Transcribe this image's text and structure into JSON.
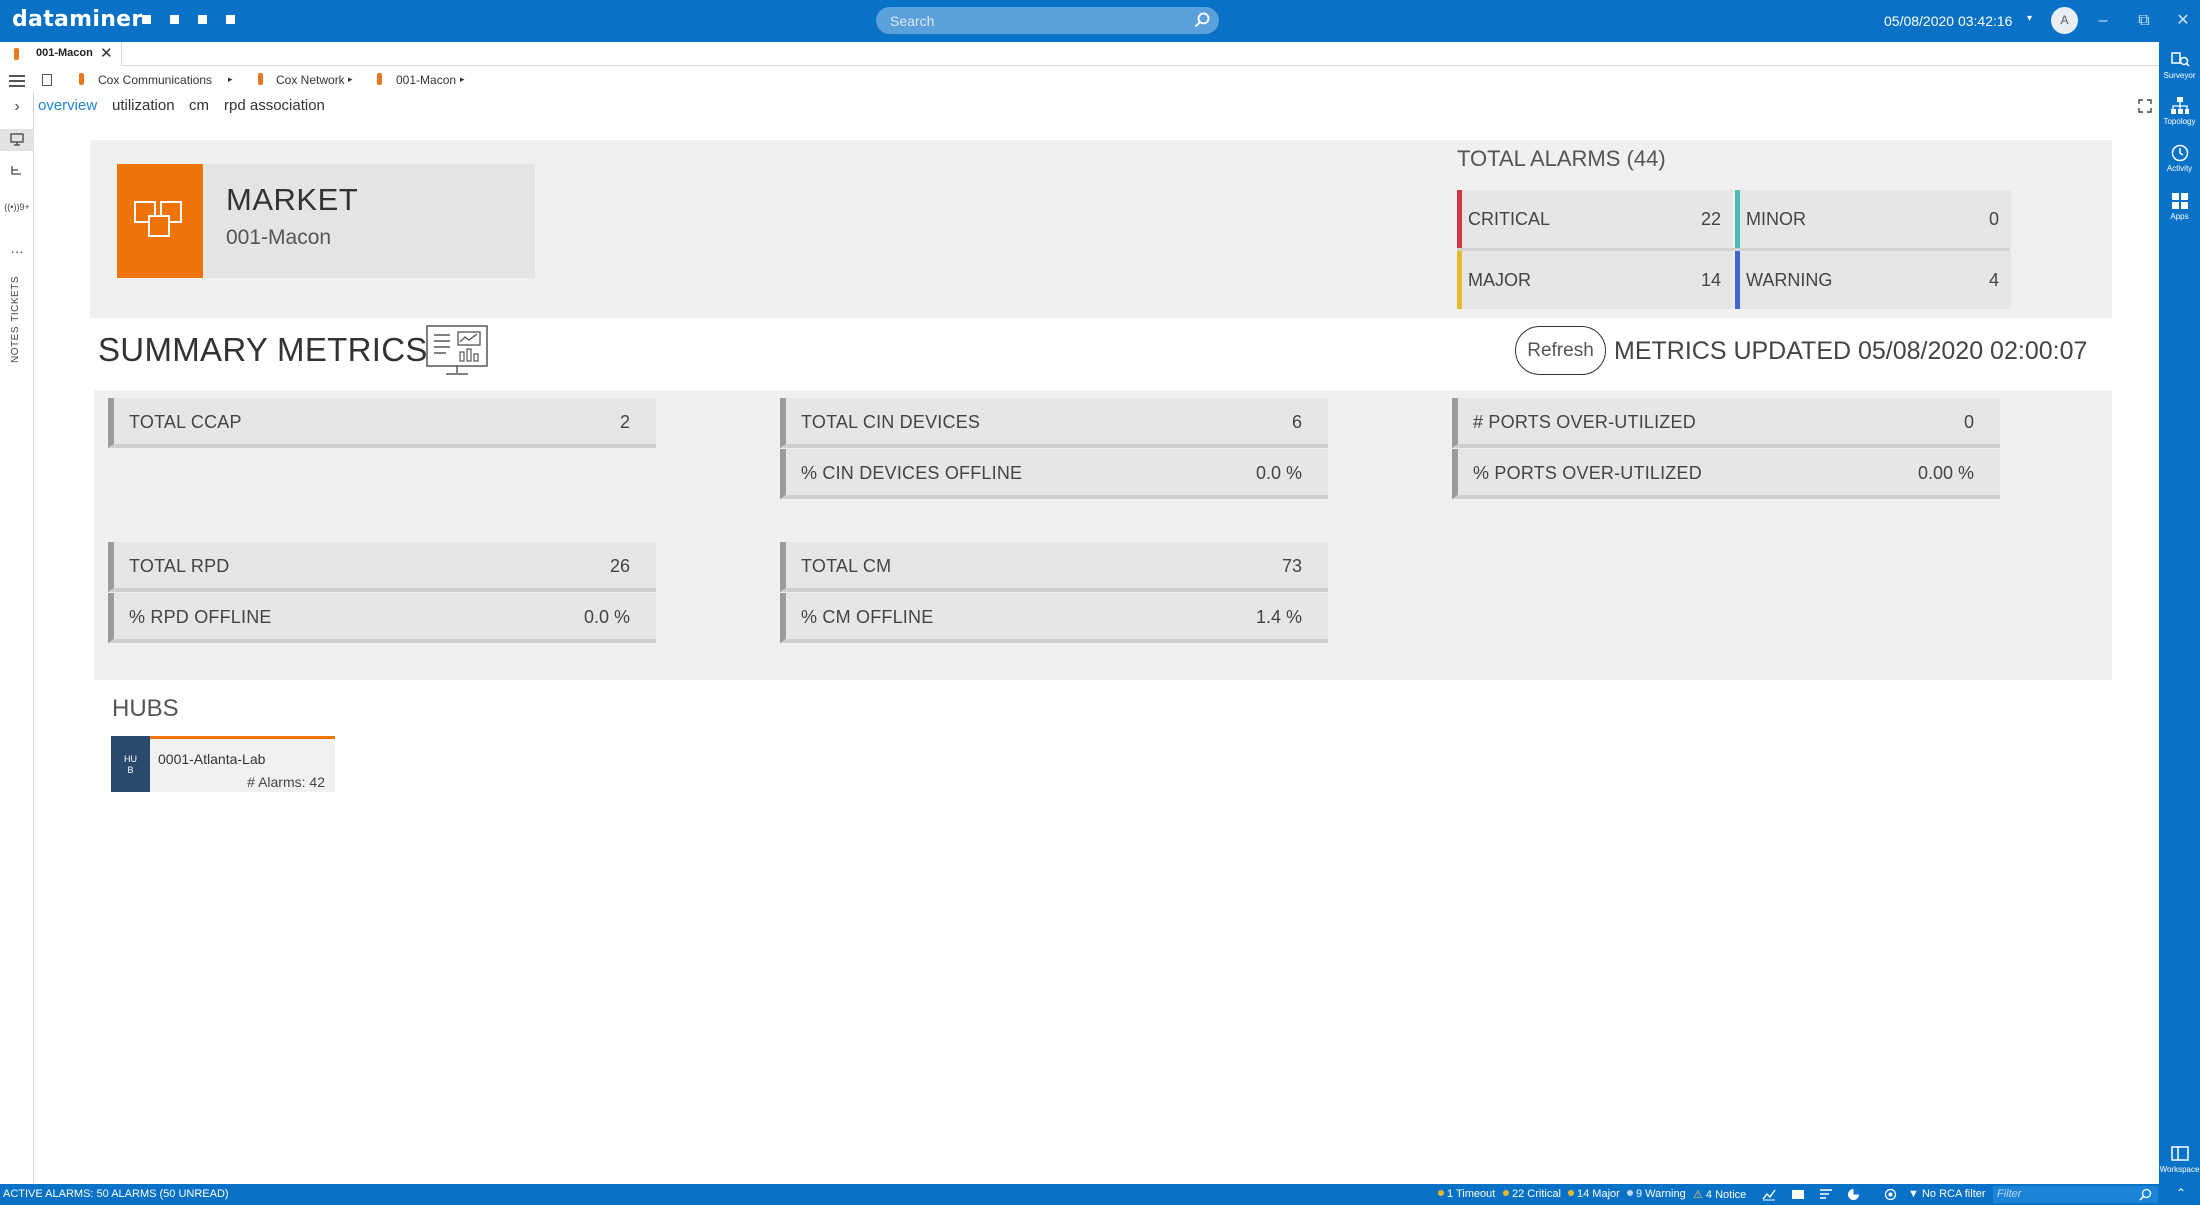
{
  "app": {
    "brand": "dataminer"
  },
  "topbar": {
    "search_placeholder": "Search",
    "datetime": "05/08/2020 03:42:16",
    "datetime_caret": "▾",
    "avatar_initial": "A",
    "minimize": "–",
    "restore": "⧉",
    "close": "✕"
  },
  "tab": {
    "label": "001-Macon",
    "close": "✕"
  },
  "breadcrumb": {
    "items": [
      {
        "label": "Cox Communications"
      },
      {
        "label": "Cox Network"
      },
      {
        "label": "001-Macon"
      }
    ],
    "arrow": "▸"
  },
  "subnav": {
    "items": [
      {
        "label": "overview",
        "active": true
      },
      {
        "label": "utilization",
        "active": false
      },
      {
        "label": "cm",
        "active": false
      },
      {
        "label": "rpd association",
        "active": false
      }
    ]
  },
  "leftrail": {
    "collapse": "›",
    "more": "…",
    "tickets": "TICKETS",
    "notes": "NOTES",
    "signal": "((•))9+"
  },
  "rightrail": {
    "items": [
      {
        "label": "Surveyor"
      },
      {
        "label": "Topology"
      },
      {
        "label": "Activity"
      },
      {
        "label": "Apps"
      }
    ],
    "workspace": "Workspace"
  },
  "market": {
    "type": "MARKET",
    "name": "001-Macon"
  },
  "alarms": {
    "title": "TOTAL ALARMS (44)",
    "cells": [
      {
        "label": "CRITICAL",
        "count": "22",
        "color": "#d8343f"
      },
      {
        "label": "MINOR",
        "count": "0",
        "color": "#4cbcbc"
      },
      {
        "label": "MAJOR",
        "count": "14",
        "color": "#e9b92c"
      },
      {
        "label": "WARNING",
        "count": "4",
        "color": "#3f66d1"
      }
    ]
  },
  "summary": {
    "title": "SUMMARY METRICS",
    "refresh": "Refresh",
    "updated": "METRICS UPDATED 05/08/2020 02:00:07"
  },
  "metrics": [
    {
      "label": "TOTAL CCAP",
      "value": "2"
    },
    {
      "label": "TOTAL CIN DEVICES",
      "value": "6"
    },
    {
      "label": "% CIN DEVICES OFFLINE",
      "value": "0.0 %"
    },
    {
      "label": "# PORTS OVER-UTILIZED",
      "value": "0"
    },
    {
      "label": "% PORTS OVER-UTILIZED",
      "value": "0.00 %"
    },
    {
      "label": "TOTAL RPD",
      "value": "26"
    },
    {
      "label": "% RPD OFFLINE",
      "value": "0.0 %"
    },
    {
      "label": "TOTAL CM",
      "value": "73"
    },
    {
      "label": "% CM OFFLINE",
      "value": "1.4 %"
    }
  ],
  "hubs": {
    "title": "HUBS",
    "items": [
      {
        "badge_top": "HU",
        "badge_bottom": "B",
        "name": "0001-Atlanta-Lab",
        "alarms": "# Alarms: 42"
      }
    ]
  },
  "statusbar": {
    "active_alarms": "ACTIVE ALARMS: 50 ALARMS (50 UNREAD)",
    "counts": [
      {
        "label": "1 Timeout",
        "color": "#e9b92c"
      },
      {
        "label": "22 Critical",
        "color": "#e9b92c"
      },
      {
        "label": "14 Major",
        "color": "#e9b92c"
      },
      {
        "label": "9 Warning",
        "color": "#bcd8f2"
      },
      {
        "label": "4 Notice",
        "color": "#e9b92c"
      }
    ],
    "rca": "No RCA filter",
    "filter_placeholder": "Filter"
  }
}
